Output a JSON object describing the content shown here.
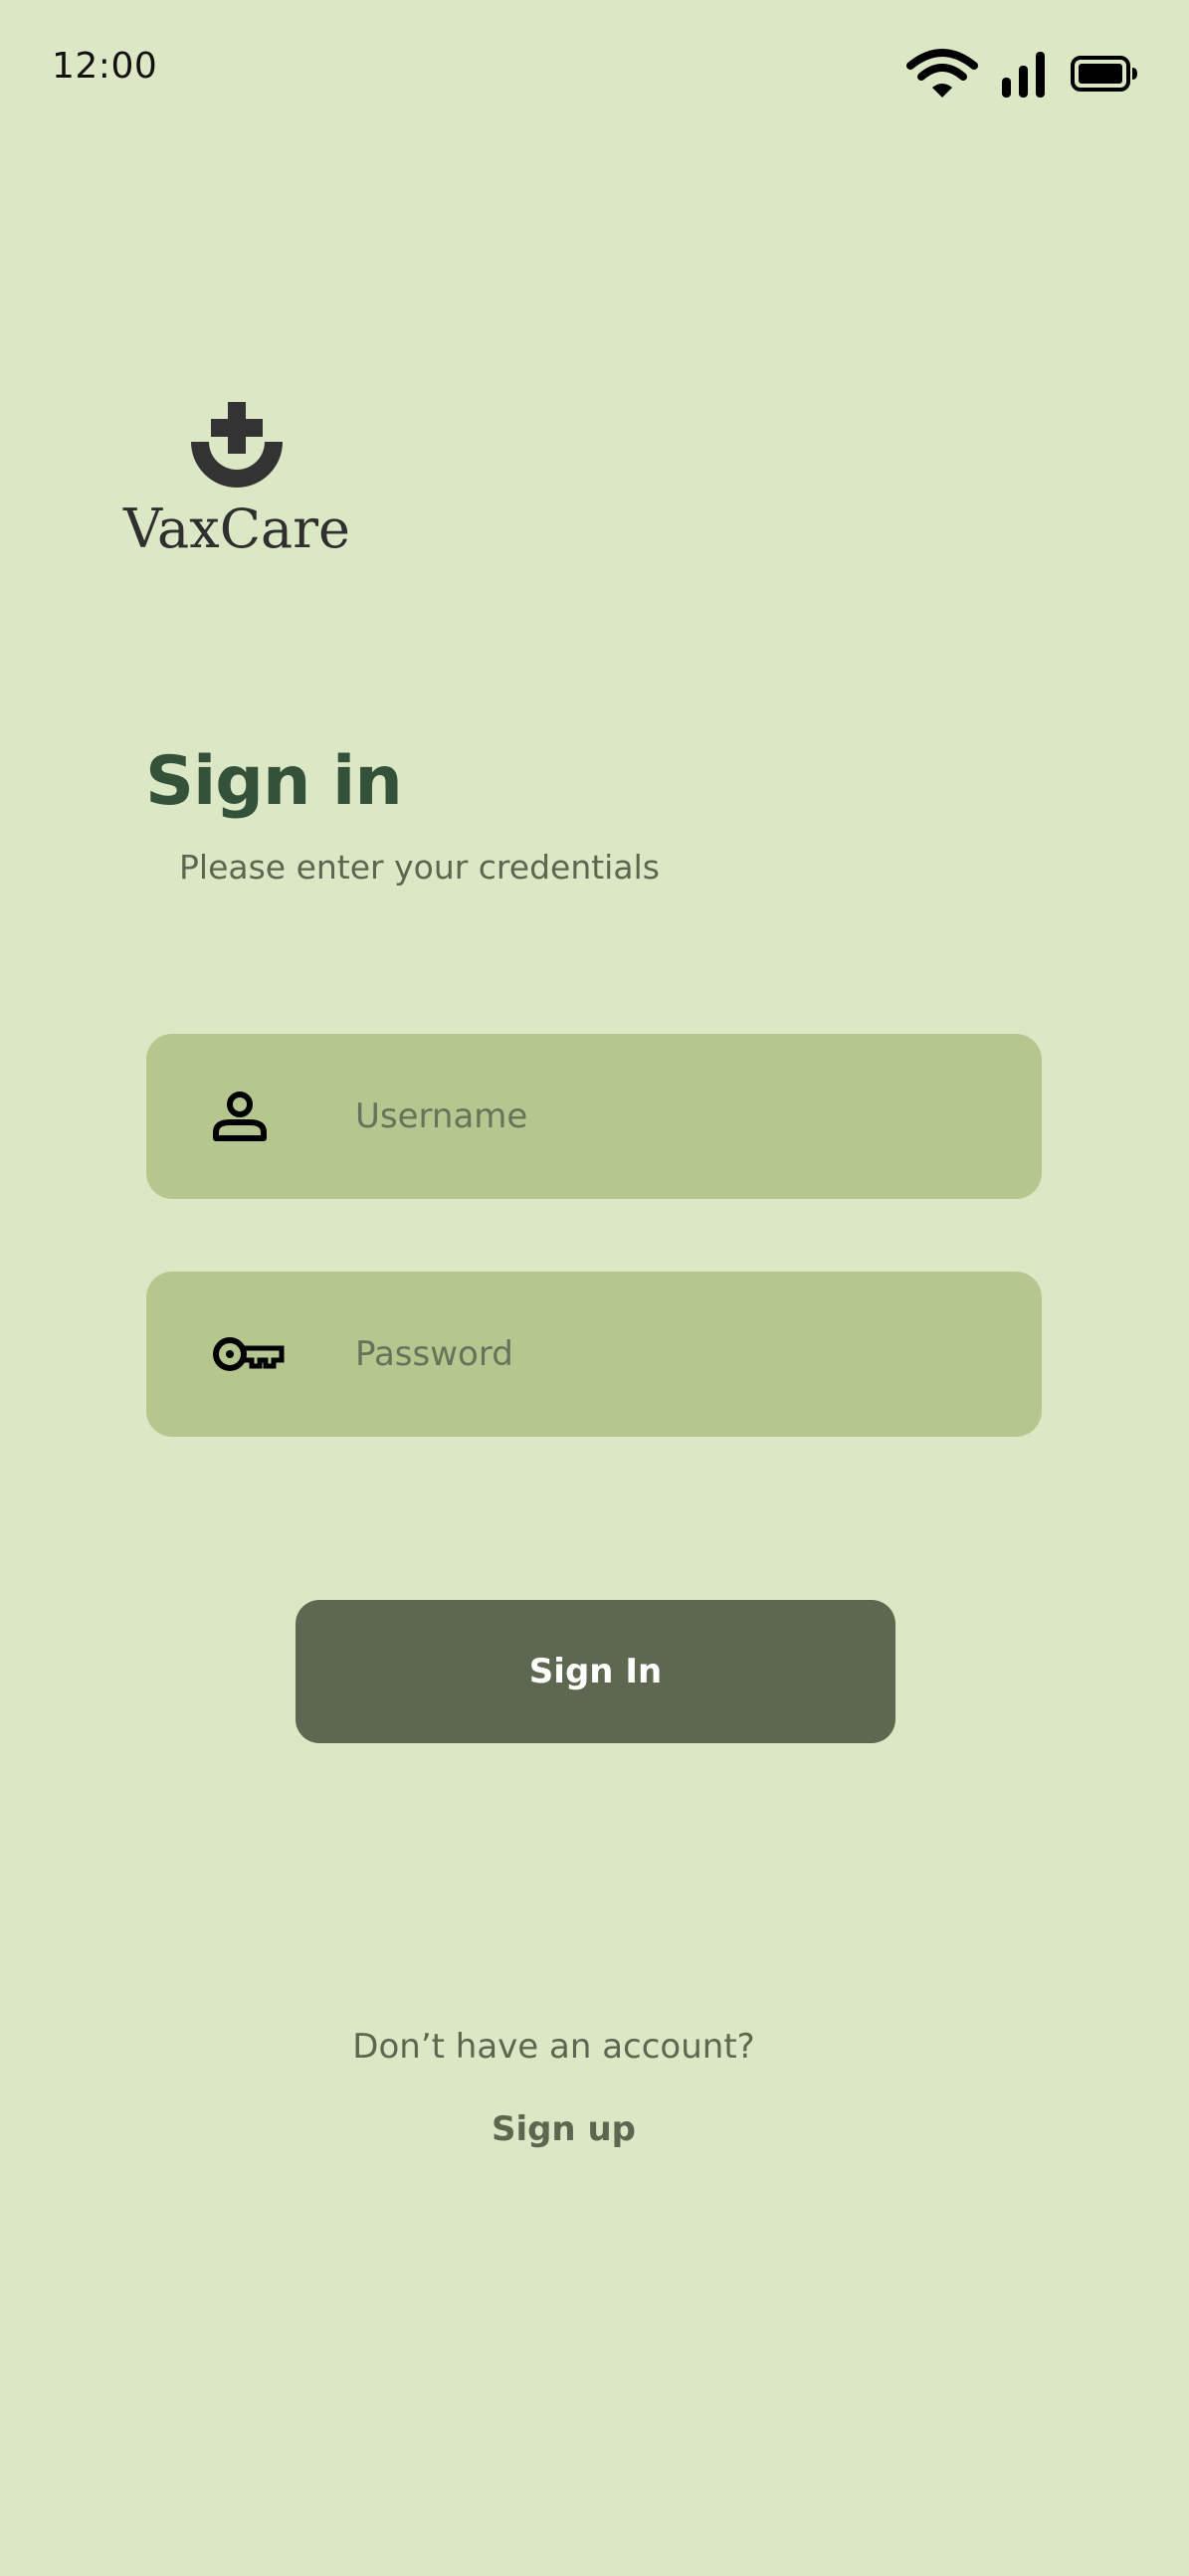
{
  "status_bar": {
    "time": "12:00",
    "icons": [
      "wifi-icon",
      "signal-icon",
      "battery-icon"
    ]
  },
  "brand": {
    "name": "VaxCare",
    "icon": "medical-cross-logo-icon"
  },
  "header": {
    "title": "Sign in",
    "subtitle": "Please enter your credentials"
  },
  "form": {
    "username": {
      "placeholder": "Username",
      "value": "",
      "icon": "user-icon"
    },
    "password": {
      "placeholder": "Password",
      "value": "",
      "icon": "key-icon"
    },
    "submit_label": "Sign In"
  },
  "footer": {
    "prompt": "Don’t have an account?",
    "signup_label": "Sign up"
  },
  "colors": {
    "background": "#dce8c5",
    "field_background": "#b5c78f",
    "button_background": "#5e6850",
    "heading": "#34513a",
    "text": "#5c6650"
  }
}
